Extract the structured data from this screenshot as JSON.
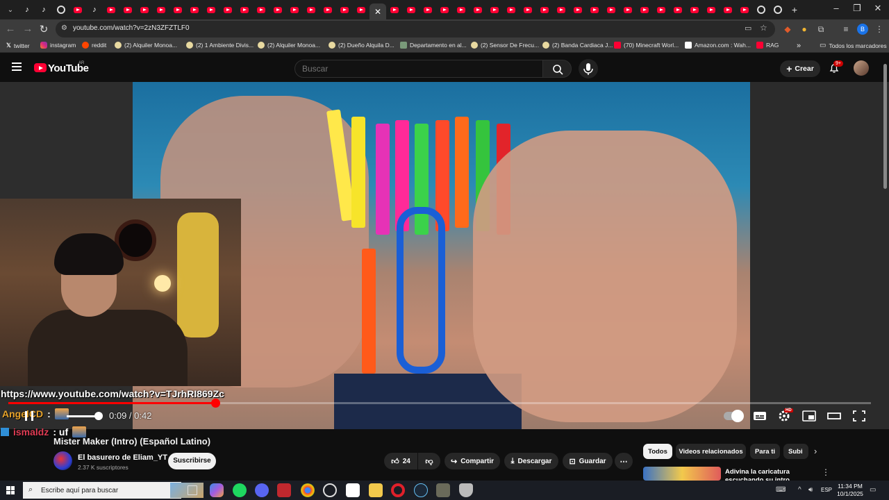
{
  "browser": {
    "url": "youtube.com/watch?v=2zN3ZFZTLF0",
    "bookmarks": [
      {
        "label": "twitter"
      },
      {
        "label": "instagram"
      },
      {
        "label": "reddit"
      },
      {
        "label": "(2) Alquiler Monoa..."
      },
      {
        "label": "(2) 1 Ambiente Divis..."
      },
      {
        "label": "(2) Alquiler Monoa..."
      },
      {
        "label": "(2) Dueño Alquila D..."
      },
      {
        "label": "Departamento en al..."
      },
      {
        "label": "(2) Sensor De Frecu..."
      },
      {
        "label": "(2) Banda Cardiaca J..."
      },
      {
        "label": "(70) Minecraft Worl..."
      },
      {
        "label": "Amazon.com : Wah..."
      },
      {
        "label": "RAG"
      }
    ],
    "more_bookmarks": "»",
    "all_bookmarks": "Todos los marcadores",
    "profile_initial": "B"
  },
  "youtube": {
    "logo_text": "YouTube",
    "region": "AR",
    "search_placeholder": "Buscar",
    "create_label": "Crear",
    "notifications_badge": "9+"
  },
  "player": {
    "overlay_url": "https://www.youtube.com/watch?v=TJrhRI869Zc",
    "current_time": "0:09",
    "duration": "0:42",
    "time_display": "0:09 / 0:42",
    "progress_fraction": 0.24,
    "hd_badge": "HD"
  },
  "stream_chat": [
    {
      "name": "AngelCD",
      "message": ":"
    },
    {
      "name": "ismaldz",
      "message": ": uf"
    }
  ],
  "video": {
    "title": "Mister Maker (Intro) (Español Latino)",
    "channel_name": "El basurero de Eliam_YT",
    "subscribers": "2.37 K suscriptores",
    "subscribe_label": "Suscribirse",
    "likes": "24",
    "share_label": "Compartir",
    "download_label": "Descargar",
    "save_label": "Guardar"
  },
  "sidebar": {
    "chips": [
      "Todos",
      "Videos relacionados",
      "Para ti",
      "Subi"
    ],
    "recommended": [
      {
        "title": "Adivina la caricatura escuchando su intro"
      }
    ]
  },
  "taskbar": {
    "search_placeholder": "Escribe aquí para buscar",
    "language": "ESP",
    "time": "11:34 PM",
    "date": "10/1/2025"
  },
  "colors": {
    "youtube_red": "#ff0033",
    "progress_red": "#ff0000",
    "chat_name_1": "#e6a22a",
    "chat_name_2": "#e03c54"
  }
}
